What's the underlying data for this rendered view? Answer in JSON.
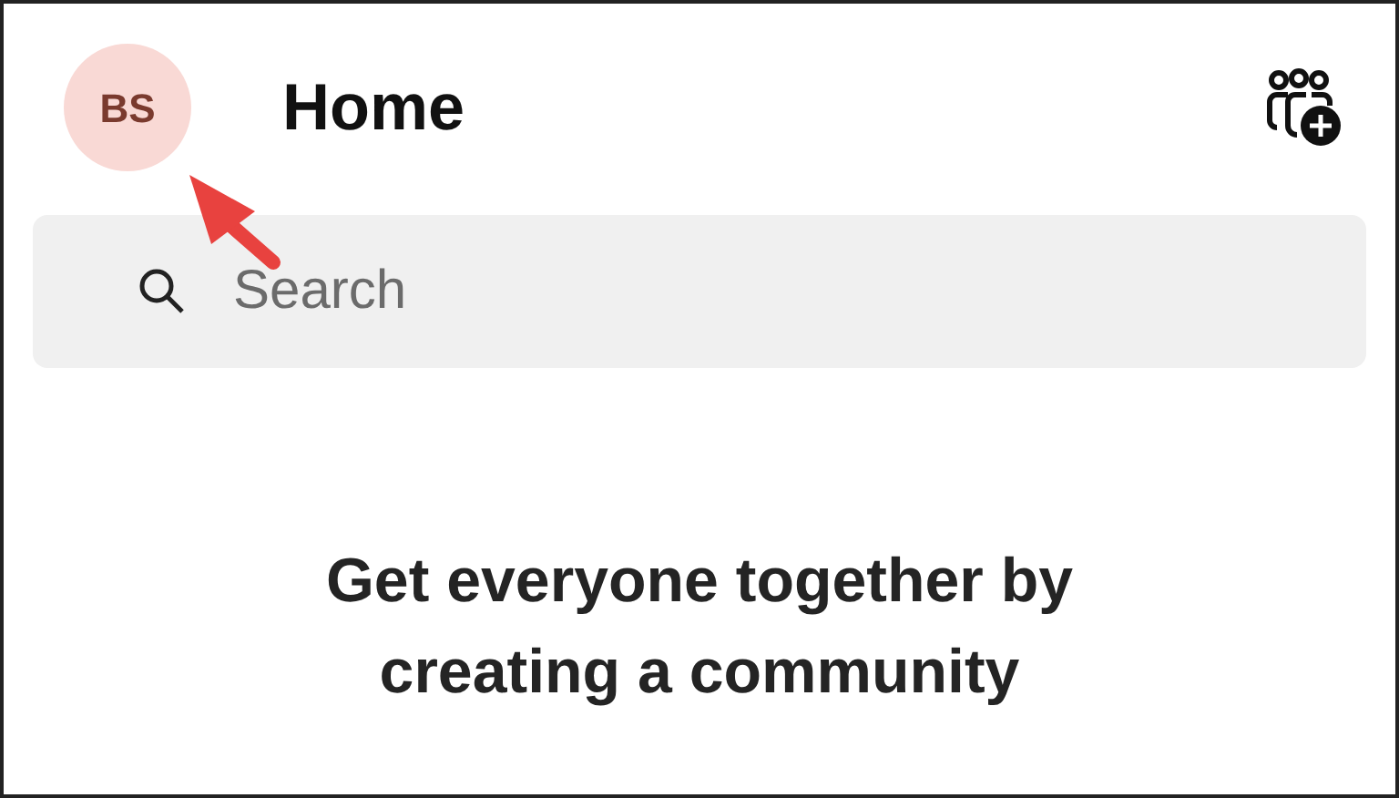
{
  "header": {
    "avatar_initials": "BS",
    "title": "Home"
  },
  "search": {
    "placeholder": "Search"
  },
  "empty_state": {
    "message": "Get everyone together by creating a community"
  }
}
